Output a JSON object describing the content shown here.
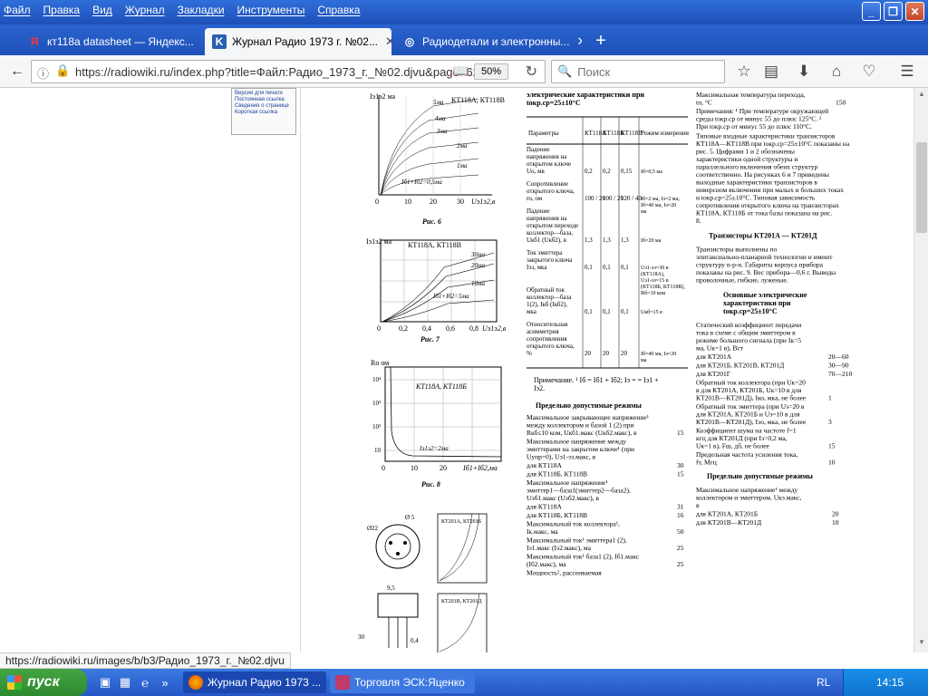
{
  "menu": [
    "Файл",
    "Правка",
    "Вид",
    "Журнал",
    "Закладки",
    "Инструменты",
    "Справка"
  ],
  "tabs": [
    {
      "label": "кт118а datasheet — Яндекс...",
      "icon": "yandex-icon",
      "active": false
    },
    {
      "label": "Журнал Радио 1973 г. №02...",
      "icon": "radiowiki-icon",
      "active": true
    },
    {
      "label": "Радиодетали и электронны...",
      "icon": "radiodetali-icon",
      "active": false
    }
  ],
  "url": "https://radiowiki.ru/index.php?title=Файл:Радио_1973_г._№02.djvu&page=62",
  "zoom": "50%",
  "search_placeholder": "Поиск",
  "status_url": "https://radiowiki.ru/images/b/b3/Радио_1973_г._№02.djvu",
  "taskbar": {
    "start": "пуск",
    "tasks": [
      "Журнал Радио 1973 ...",
      "Торговля ЭСК:Яценко"
    ],
    "lang": "RL",
    "clock": "14:15"
  },
  "sidebar_links": [
    "Версия для печати",
    "Постоянная ссылка",
    "Сведения о странице",
    "Короткая ссылка"
  ],
  "doc": {
    "fig6": {
      "caption": "Рис. 6",
      "ylabel": "Iэ1э2 ма",
      "series": [
        "5ма",
        "4ма",
        "3ма",
        "2ма",
        "1ма"
      ],
      "label": "Iб1+Iб2=0,5ма",
      "xticks": [
        "0",
        "10",
        "20",
        "30"
      ],
      "xlabel": "Uэ1э2,в",
      "legend": "КТ118А, КТ118В"
    },
    "fig7": {
      "caption": "Рис. 7",
      "ylabel": "Iэ1э2 ма",
      "series": [
        "30ма",
        "20ма",
        "10ма"
      ],
      "label": "Iб1+Iб2=5ма",
      "xticks": [
        "0",
        "0,2",
        "0,4",
        "0,6",
        "0,8"
      ],
      "xlabel": "Uэ1э2,в",
      "legend": "КТ118А, КТ118В"
    },
    "fig8": {
      "caption": "Рис. 8",
      "ylabel": "Rо ом",
      "yticks": [
        "10⁴",
        "10³",
        "10²",
        "10"
      ],
      "label": "Iэ1э2=2ма",
      "xticks": [
        "0",
        "10",
        "20"
      ],
      "xlabel": "Iб1+Iб2,ма",
      "legend": "КТ118А, КТ118Б"
    },
    "fig9": {
      "caption": "Рис. 9",
      "legend1": "КТ201А, КТ201Б",
      "legend2": "КТ201В, КТ201Д",
      "dims": [
        "Ø22",
        "Ø 5",
        "9,5",
        "30",
        "0,4"
      ]
    },
    "col2": {
      "header": "электрические характеристики при tокр.ср=25±10°С",
      "table_head": [
        "Параметры",
        "КТ118А",
        "КТ118Б",
        "КТ118В",
        "Режим измерения"
      ],
      "rows": [
        {
          "p": "Падение напряжения на открытом ключе Uо, мв",
          "a": "0,2",
          "b": "0,2",
          "c": "0,15",
          "m": "Iб=0,5 ма"
        },
        {
          "p": "Сопротивление открытого ключа, rо, ом",
          "a": "100 / 20",
          "b": "100 / 20",
          "c": "120 / 40",
          "m": "Iб=2 ма, Iэ=2 ма; Iб=40 ма, Iэ=20 ма"
        },
        {
          "p": "Падение напряжения на открытом переходе коллектор—база, Uкб1 (Uкб2), в",
          "a": "1,3",
          "b": "1,3",
          "c": "1,3",
          "m": "Iб=20 ма"
        },
        {
          "p": "Ток эмиттера закрытого ключа Iэз, мка",
          "a": "0,1",
          "b": "0,1",
          "c": "0,1",
          "m": "Uэ1-эз=30 в (КТ118А), Uэ1-эз=15 в (КТ118Б, КТ118В), Rб=10 ком"
        },
        {
          "p": "Обратный ток коллектор—база 1(2), Iкб (Iкб2), мка",
          "a": "0,1",
          "b": "0,1",
          "c": "0,1",
          "m": "Uкб=15 в"
        },
        {
          "p": "Относительная асимметрия сопротивления открытого ключа, %",
          "a": "20",
          "b": "20",
          "c": "20",
          "m": "Iб=40 ма, Iэ=20 ма"
        }
      ],
      "note": "Примечание. ¹ Iб = Iб1 + Iб2; Iэ = = Iэ1 + Iэ2.",
      "limits_title": "Предельно допустимые режимы",
      "limits": [
        {
          "t": "Максимальное закрывающее напряжение¹ между коллектором и базой 1 (2) при Rкб≤10 ком, Uкб1.макс (Uкб2.макс), в",
          "v": "15"
        },
        {
          "t": "Максимальное напряжение между эмиттерами на закрытом ключе¹ (при Uупр=0), Uэ1-эз.макс, в",
          "v": ""
        },
        {
          "t": "для КТ118А",
          "v": "30"
        },
        {
          "t": "для КТ118Б, КТ118В",
          "v": "15"
        },
        {
          "t": "Максимальное напряжение¹ эмиттер1—база1(эмиттер2—база2), Uэб1.макс (Uэб2.макс), в",
          "v": ""
        },
        {
          "t": "для КТ118А",
          "v": "31"
        },
        {
          "t": "для КТ118Б, КТ118В",
          "v": "16"
        },
        {
          "t": "Максимальный ток коллектора¹, Iк.макс, ма",
          "v": "50"
        },
        {
          "t": "Максимальный ток¹ эмиттера1 (2), Iэ1.макс (Iэ2.макс), ма",
          "v": "25"
        },
        {
          "t": "Максимальный ток¹ база1 (2), Iб1.макс (Iб2.макс), ма",
          "v": "25"
        },
        {
          "t": "Мощность², рассеиваемая",
          "v": ""
        }
      ]
    },
    "col3": {
      "top1": "Максимальная температура перехода, tп, °С",
      "top1v": "150",
      "notes": "Примечания: ¹ При температуре окружающей среды tокр.ср от минус 55 до плюс 125°С. ² При tокр.ср от минус 55 до плюс 110°С.",
      "para1": "Типовые входные характеристики транзисторов КТ118А—КТ118В при tокр.ср=25±10°С показаны на рис. 5. Цифрами 1 и 2 обозначены характеристики одной структуры и параллельного включения обеих структур соответственно. На рисунках 6 и 7 приведены выходные характеристики транзисторов в инверсном включении при малых и больших токах и tокр.ср=25±10°С. Типовая зависимость сопротивления открытого ключа на транзисторах КТ118А, КТ118Б от тока базы показана на рис. 8.",
      "h1": "Транзисторы КТ201А — КТ201Д",
      "para2": "Транзисторы выполнены по эпитаксиально-планарной технологии и имеют структуру n-p-n. Габариты корпуса прибора показаны на рис. 9. Вес прибора—0,6 г. Выводы проволочные, гибкие, луженые.",
      "h2": "Основные электрические характеристики при tокр.ср=25±10°С",
      "items": [
        {
          "t": "Статический коэффициент передачи тока в схеме с общим эмиттером в режиме большого сигнала (при Iк=5 ма, Uк=1 в), Bст",
          "v": ""
        },
        {
          "t": "для КТ201А",
          "v": "20—60"
        },
        {
          "t": "для КТ201Б, КТ201В, КТ201Д",
          "v": "30—90"
        },
        {
          "t": "для КТ201Г",
          "v": "70—210"
        },
        {
          "t": "Обратный ток коллектора (при Uк=20 в для КТ201А, КТ201Б, Uк=10 в для КТ201В—КТ201Д), Iко, мка, не более",
          "v": "1"
        },
        {
          "t": "Обратный ток эмиттера (при Uэ=20 в для КТ201А, КТ201Б и Uэ=10 в для КТ201В—КТ201Д), Iэо, мка, не более",
          "v": "3"
        },
        {
          "t": "Коэффициент шума на частоте f=1 кгц для КТ201Д (при Iэ=0,2 ма, Uк=1 в), Fш, дб, не более",
          "v": "15"
        },
        {
          "t": "Предельная частота усиления тока, fт, Мгц",
          "v": "10"
        }
      ],
      "h3": "Предельно допустимые режимы",
      "limits": [
        {
          "t": "Максимальное напряжение¹ между коллектором и эмиттером, Uкэ.макс, в",
          "v": ""
        },
        {
          "t": "для КТ201А, КТ201Б",
          "v": "20"
        },
        {
          "t": "для КТ201В—КТ201Д",
          "v": "10"
        }
      ]
    }
  },
  "colors": {
    "titlebar": "#2f6fd9",
    "taskbar": "#2556c5",
    "start": "#3a9a3a"
  }
}
